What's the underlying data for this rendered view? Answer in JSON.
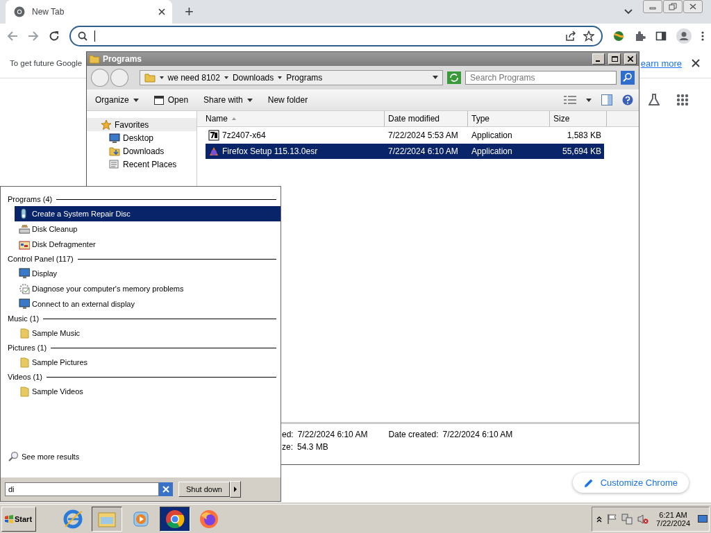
{
  "browser": {
    "tab": {
      "title": "New Tab"
    },
    "new_tab_button": "+",
    "infobar": {
      "text": "To get future Google",
      "link": "earn more"
    },
    "customize_button": "Customize Chrome"
  },
  "explorer": {
    "title": "Programs",
    "breadcrumb": [
      "we need 8102",
      "Downloads",
      "Programs"
    ],
    "search": {
      "placeholder": "Search Programs"
    },
    "toolbar": [
      {
        "label": "Organize",
        "kind": "menu"
      },
      {
        "label": "Open",
        "kind": "icon"
      },
      {
        "label": "Share with",
        "kind": "menu"
      },
      {
        "label": "New folder",
        "kind": "plain"
      }
    ],
    "nav": [
      {
        "label": "Favorites",
        "kind": "star",
        "selected": true
      },
      {
        "label": "Desktop",
        "kind": "desktop",
        "selected": false
      },
      {
        "label": "Downloads",
        "kind": "downloads",
        "selected": false
      },
      {
        "label": "Recent Places",
        "kind": "places",
        "selected": false
      }
    ],
    "columns": [
      "Name",
      "Date modified",
      "Type",
      "Size"
    ],
    "rows": [
      {
        "name": "7z2407-x64",
        "date": "7/22/2024 5:53 AM",
        "type": "Application",
        "size": "1,583 KB",
        "kind": "archive",
        "selected": false
      },
      {
        "name": "Firefox Setup 115.13.0esr",
        "date": "7/22/2024 6:10 AM",
        "type": "Application",
        "size": "55,694 KB",
        "kind": "installer",
        "selected": true
      }
    ],
    "details": [
      {
        "label": "ed:",
        "value": "7/22/2024 6:10 AM"
      },
      {
        "label": "Date created:",
        "value": "7/22/2024 6:10 AM"
      },
      {
        "label": "ze:",
        "value": "54.3 MB"
      }
    ]
  },
  "start_menu": {
    "groups": [
      {
        "title": "Programs (4)",
        "items": [
          {
            "label": "Create a System Repair Disc",
            "kind": "repair",
            "selected": true
          },
          {
            "label": "Disk Cleanup",
            "kind": "cleanup",
            "selected": false
          },
          {
            "label": "Disk Defragmenter",
            "kind": "defrag",
            "selected": false
          }
        ]
      },
      {
        "title": "Control Panel (117)",
        "items": [
          {
            "label": "Display",
            "kind": "monitor",
            "selected": false
          },
          {
            "label": "Diagnose your computer's memory problems",
            "kind": "memory",
            "selected": false
          },
          {
            "label": "Connect to an external display",
            "kind": "monitor",
            "selected": false
          }
        ]
      },
      {
        "title": "Music (1)",
        "items": [
          {
            "label": "Sample Music",
            "kind": "folder",
            "selected": false
          }
        ]
      },
      {
        "title": "Pictures (1)",
        "items": [
          {
            "label": "Sample Pictures",
            "kind": "folder",
            "selected": false
          }
        ]
      },
      {
        "title": "Videos (1)",
        "items": [
          {
            "label": "Sample Videos",
            "kind": "folder",
            "selected": false
          }
        ]
      }
    ],
    "see_more": "See more results",
    "search": {
      "value": "di"
    },
    "shutdown": "Shut down"
  },
  "taskbar": {
    "start": "Start",
    "apps": [
      {
        "kind": "ie",
        "pressed": false
      },
      {
        "kind": "explorer",
        "pressed": true
      },
      {
        "kind": "media",
        "pressed": false
      },
      {
        "kind": "chrome",
        "pressed": true
      },
      {
        "kind": "firefox",
        "pressed": false
      }
    ],
    "clock": {
      "time": "6:21 AM",
      "date": "7/22/2024"
    }
  }
}
